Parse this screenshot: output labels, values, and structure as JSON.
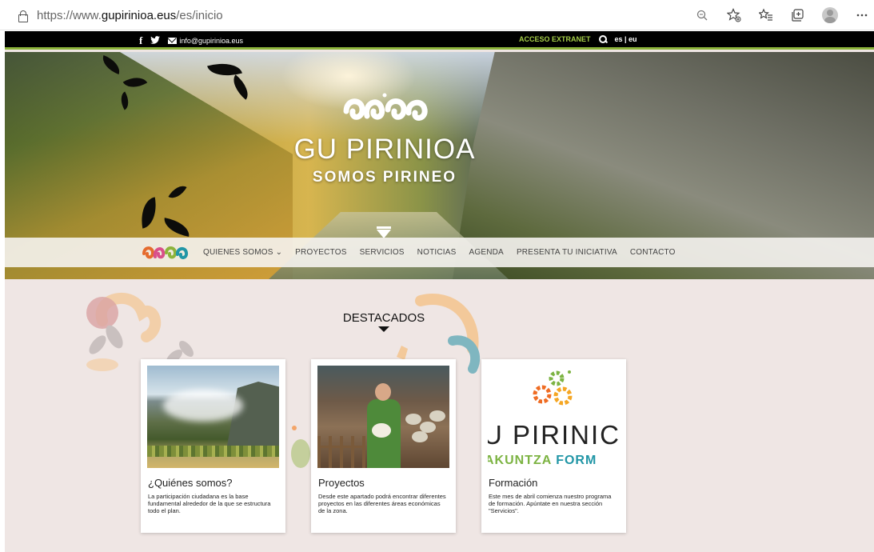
{
  "browser": {
    "url_prefix": "https://www.",
    "url_domain": "gupirinioa.eus",
    "url_path": "/es/inicio",
    "icons": [
      "zoom-icon",
      "favorite-add-icon",
      "favorites-icon",
      "collections-icon",
      "profile-icon",
      "more-icon"
    ]
  },
  "topbar": {
    "email": "info@gupirinioa.eus",
    "extranet": "ACCESO EXTRANET",
    "languages": "es | eu",
    "colors": {
      "background": "#000000",
      "accent": "#8db33b",
      "extranet": "#a6cf48"
    }
  },
  "hero": {
    "title": "GU PIRINIOA",
    "subtitle": "SOMOS PIRINEO"
  },
  "nav": {
    "items": [
      {
        "label": "QUIENES SOMOS ⌄"
      },
      {
        "label": "PROYECTOS"
      },
      {
        "label": "SERVICIOS"
      },
      {
        "label": "NOTICIAS"
      },
      {
        "label": "AGENDA"
      },
      {
        "label": "PRESENTA TU INICIATIVA"
      },
      {
        "label": "CONTACTO"
      }
    ]
  },
  "featured": {
    "title": "DESTACADOS",
    "cards": [
      {
        "title": "¿Quiénes somos?",
        "text": "La participación ciudadana es la base fundamental alrededor de la que se estructura todo el plan."
      },
      {
        "title": "Proyectos",
        "text": "Desde este apartado podrá encontrar diferentes proyectos en las diferentes áreas económicas de la zona."
      },
      {
        "title": "Formación",
        "text": "Este mes de abril comienza nuestro programa de formación. Apúntate en nuestra sección \"Servicios\".",
        "image_text_main": "U PIRINIC",
        "image_text_sub_a": "AKUNTZA",
        "image_text_sub_b": "FORM"
      }
    ]
  }
}
